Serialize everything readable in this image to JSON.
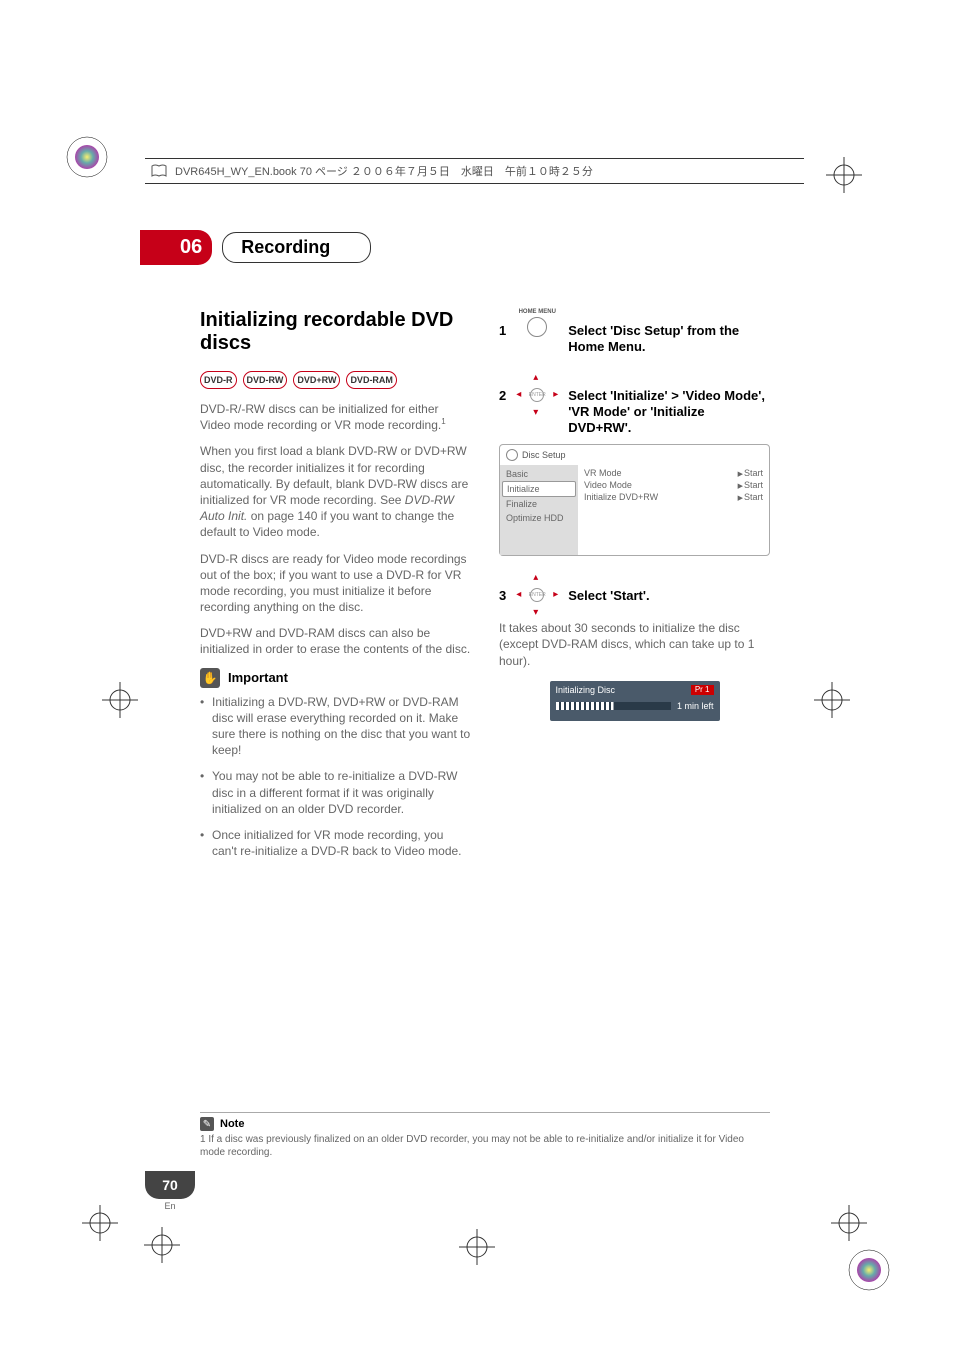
{
  "header": {
    "file_line": "DVR645H_WY_EN.book  70 ページ  ２００６年７月５日　水曜日　午前１０時２５分"
  },
  "chapter": {
    "num": "06",
    "title": "Recording"
  },
  "left": {
    "section_title": "Initializing recordable DVD discs",
    "tags": [
      "DVD-R",
      "DVD-RW",
      "DVD+RW",
      "DVD-RAM"
    ],
    "p1a": "DVD-R/-RW discs can be initialized for either Video mode recording or VR mode recording.",
    "sup1": "1",
    "p2a": "When you first load a blank DVD-RW or DVD+RW disc, the recorder initializes it for recording automatically. By default, blank DVD-RW discs are initialized for VR mode recording. See ",
    "p2i": "DVD-RW Auto Init.",
    "p2b": " on page 140 if you want to change the default to Video mode.",
    "p3": "DVD-R discs are ready for Video mode recordings out of the box; if you want to use a DVD-R for VR mode recording, you must initialize it before recording anything on the disc.",
    "p4": "DVD+RW and DVD-RAM discs can also be initialized in order to erase the contents of the disc.",
    "important_label": "Important",
    "b1": "Initializing a DVD-RW, DVD+RW or DVD-RAM disc will erase everything recorded on it. Make sure there is nothing on the disc that you want to keep!",
    "b2": "You may not be able to re-initialize a DVD-RW disc in a different format if it was originally initialized on an older DVD recorder.",
    "b3": "Once initialized for VR mode recording, you can't re-initialize a DVD-R back to Video mode."
  },
  "right": {
    "step1_num": "1",
    "step1_icon_label": "HOME MENU",
    "step1_text": "Select 'Disc Setup' from the Home Menu.",
    "step2_num": "2",
    "step2_text": "Select 'Initialize' > 'Video Mode',  'VR Mode' or 'Initialize DVD+RW'.",
    "ui": {
      "title": "Disc Setup",
      "menu": [
        "Basic",
        "Initialize",
        "Finalize",
        "Optimize HDD"
      ],
      "options": [
        {
          "label": "VR Mode",
          "action": "Start"
        },
        {
          "label": "Video Mode",
          "action": "Start"
        },
        {
          "label": "Initialize DVD+RW",
          "action": "Start"
        }
      ]
    },
    "step3_num": "3",
    "step3_text": "Select 'Start'.",
    "step3_sub": "It takes about 30 seconds to initialize the disc (except DVD-RAM discs, which can take up to 1 hour).",
    "progress": {
      "title": "Initializing Disc",
      "badge": "Pr 1",
      "time": "1 min left"
    }
  },
  "note": {
    "label": "Note",
    "text": "1 If a disc was previously finalized on an older DVD recorder, you may not be able to re-initialize and/or initialize it for Video mode recording."
  },
  "page": {
    "num": "70",
    "lang": "En"
  }
}
